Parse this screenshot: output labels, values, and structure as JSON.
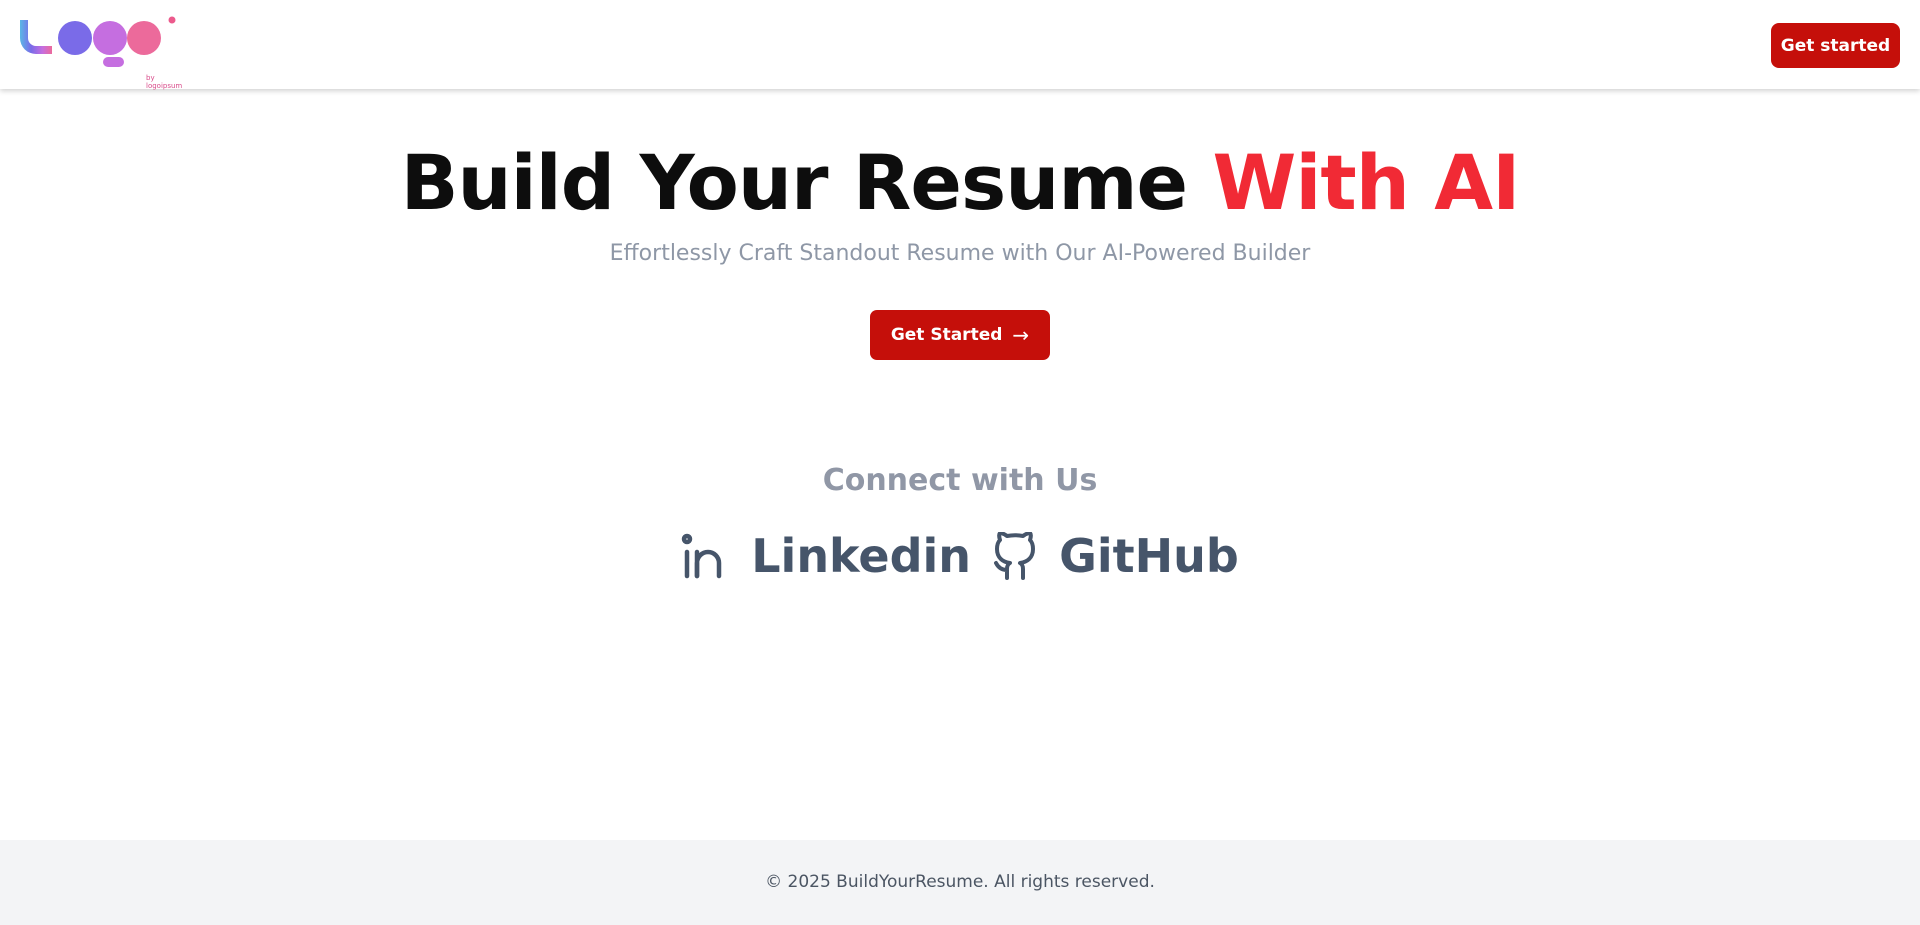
{
  "header": {
    "logo_alt": "logo",
    "logo_sub": "by logoipsum",
    "cta_label": "Get started"
  },
  "hero": {
    "title_main": "Build Your Resume ",
    "title_accent": "With AI",
    "subtitle": "Effortlessly Craft Standout Resume with Our AI-Powered Builder",
    "cta_label": "Get Started",
    "cta_arrow": "→"
  },
  "connect": {
    "title": "Connect with Us",
    "links": [
      {
        "label": "Linkedin",
        "icon": "linkedin-icon"
      },
      {
        "label": "GitHub",
        "icon": "github-icon"
      }
    ]
  },
  "footer": {
    "copyright": "© 2025 BuildYourResume. All rights reserved."
  },
  "colors": {
    "brand_red": "#c50f0a",
    "accent_red": "#f12a35",
    "muted_gray": "#8e97a6",
    "social_gray": "#46556a",
    "footer_bg": "#f3f4f6"
  }
}
